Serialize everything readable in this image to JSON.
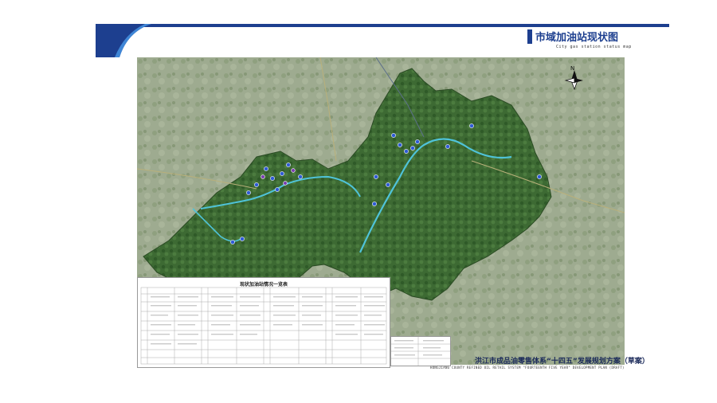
{
  "header": {
    "title": "市域加油站现状图",
    "subtitle": "City gas station status map"
  },
  "map": {
    "north_label": "N",
    "colors": {
      "background_terrain": "#9aa98c",
      "county_fill": "#3f6b34",
      "river": "#4fc3d9",
      "station_marker": "#2f5bd6",
      "brand": "#1d3f8f"
    },
    "station_icon": "fuel-station-icon"
  },
  "table": {
    "title": "现状加油站情况一览表"
  },
  "footer": {
    "plan_title": "洪江市成品油零售体系“十四五”发展规划方案（草案）",
    "plan_subtitle": "HONGJIANG COUNTY REFINED OIL RETAIL SYSTEM \"FOURTEENTH FIVE YEAR\" DEVELOPMENT PLAN (DRAFT)"
  }
}
